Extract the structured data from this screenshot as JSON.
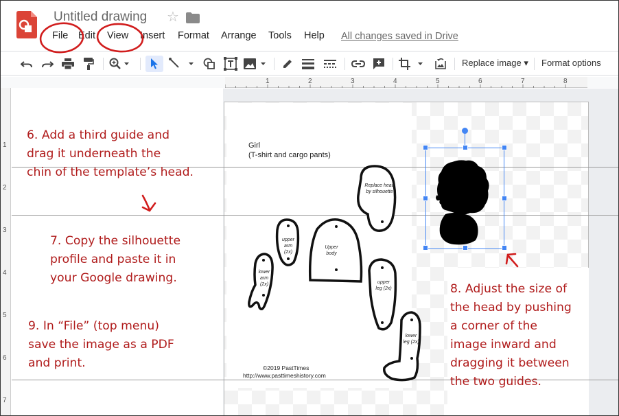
{
  "app": {
    "title": "Untitled drawing",
    "icon": "google-drawings-icon",
    "brand_color": "#db4437"
  },
  "menu": {
    "items": [
      {
        "label": "File"
      },
      {
        "label": "Edit"
      },
      {
        "label": "View"
      },
      {
        "label": "Insert"
      },
      {
        "label": "Format"
      },
      {
        "label": "Arrange"
      },
      {
        "label": "Tools"
      },
      {
        "label": "Help"
      }
    ],
    "status": "All changes saved in Drive"
  },
  "toolbar": {
    "replace_image_label": "Replace image",
    "format_options_label": "Format options",
    "icons": [
      "undo-icon",
      "redo-icon",
      "print-icon",
      "paint-format-icon",
      "zoom-icon",
      "select-icon",
      "line-icon",
      "shape-icon",
      "text-box-icon",
      "image-icon",
      "pen-icon",
      "line-weight-icon",
      "line-dash-icon",
      "link-icon",
      "comment-icon",
      "crop-icon",
      "reset-image-icon"
    ]
  },
  "rulers": {
    "top": [
      "1",
      "2",
      "3",
      "4",
      "5",
      "6",
      "7",
      "8"
    ],
    "left": [
      "1",
      "2",
      "3",
      "4",
      "5",
      "6",
      "7"
    ]
  },
  "page": {
    "title": "Girl",
    "subtitle": "(T-shirt and cargo pants)",
    "copyright": "©2019 PastTimes",
    "url": "http://www.pasttimeshistory.com",
    "template_labels": {
      "head": "Replace head by silhouette",
      "upper_arm": "upper arm (2x)",
      "lower_arm": "lower arm (2x)",
      "upper_body": "Upper body",
      "upper_leg": "upper leg (2x)",
      "lower_leg": "lower leg (2x)"
    }
  },
  "notes": {
    "step6": [
      "6. Add a third guide and",
      "drag it underneath the",
      "chin of the template’s head."
    ],
    "step7": [
      "7. Copy the silhouette",
      "profile and paste it in",
      "your Google drawing."
    ],
    "step8": [
      "8. Adjust the size of",
      "the head by pushing",
      "a corner of the",
      "image inward and",
      "dragging it between",
      "the two guides."
    ],
    "step9": [
      "9. In “File” (top menu)",
      "save the image as a PDF",
      "and print."
    ],
    "annotation_color": "#b01c1c"
  }
}
